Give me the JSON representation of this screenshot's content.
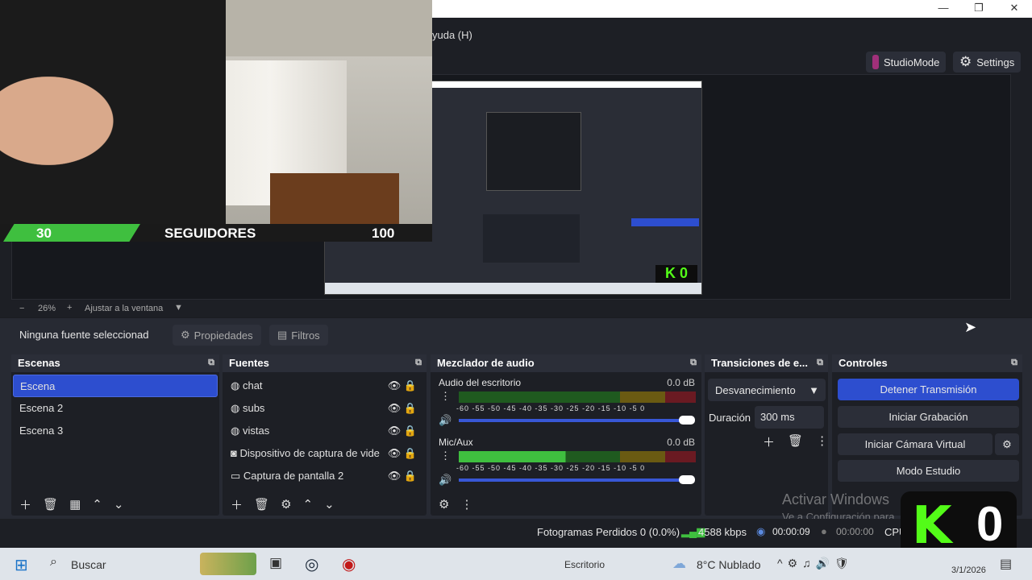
{
  "window": {
    "menu_partial": "yuda (H)"
  },
  "top_buttons": {
    "studio_mode": "StudioMode",
    "settings": "Settings"
  },
  "overlay": {
    "follow_current": "30",
    "follow_label": "SEGUIDORES",
    "follow_goal": "100",
    "kick_count": "0"
  },
  "zoom": {
    "minus": "−",
    "value": "26%",
    "plus": "+",
    "fit": "Ajustar a la ventana"
  },
  "source_toolbar": {
    "no_source": "Ninguna fuente seleccionad",
    "properties": "Propiedades",
    "filters": "Filtros"
  },
  "scenes": {
    "title": "Escenas",
    "items": [
      {
        "label": "Escena",
        "selected": true
      },
      {
        "label": "Escena 2"
      },
      {
        "label": "Escena 3"
      }
    ]
  },
  "sources": {
    "title": "Fuentes",
    "items": [
      {
        "label": "chat",
        "icon": "globe-icon"
      },
      {
        "label": "subs",
        "icon": "globe-icon"
      },
      {
        "label": "vistas",
        "icon": "globe-icon"
      },
      {
        "label": "Dispositivo de captura de vide",
        "icon": "camera-icon"
      },
      {
        "label": "Captura de pantalla 2",
        "icon": "monitor-icon"
      }
    ]
  },
  "mixer": {
    "title": "Mezclador de audio",
    "channels": [
      {
        "name": "Audio del escritorio",
        "db": "0.0 dB",
        "level": 0
      },
      {
        "name": "Mic/Aux",
        "db": "0.0 dB",
        "level": 0.45
      }
    ],
    "scale": [
      "-60",
      "-55",
      "-50",
      "-45",
      "-40",
      "-35",
      "-30",
      "-25",
      "-20",
      "-15",
      "-10",
      "-5",
      "0"
    ]
  },
  "transitions": {
    "title": "Transiciones de e...",
    "selected": "Desvanecimiento",
    "duration_label": "Duración",
    "duration_value": "300 ms"
  },
  "controls": {
    "title": "Controles",
    "stop_stream": "Detener Transmisión",
    "start_recording": "Iniciar Grabación",
    "virtual_cam": "Iniciar Cámara Virtual",
    "studio_mode": "Modo Estudio"
  },
  "watermark": {
    "line1": "Activar Windows",
    "line2": "Ve a Configuración para"
  },
  "status": {
    "dropped": "Fotogramas Perdidos 0 (0.0%)",
    "kbps": "4588 kbps",
    "live_time": "00:00:09",
    "rec_time": "00:00:00",
    "cpu": "CPU"
  },
  "taskbar": {
    "search": "Buscar",
    "desktop": "Escritorio",
    "weather": "8°C  Nublado",
    "date": "3/1/2026"
  },
  "colors": {
    "accent": "#2d4ecf",
    "kick_green": "#53fc18",
    "meter_green": "#3fbf3f"
  }
}
